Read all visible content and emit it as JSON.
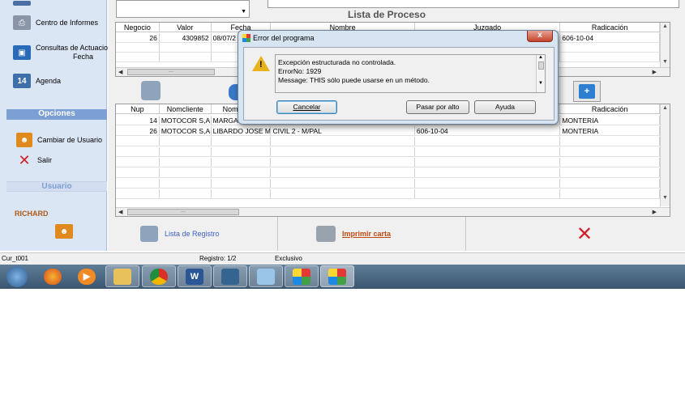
{
  "sidebar": {
    "items": [
      {
        "label": "Centro de Informes",
        "icon": "printer-icon"
      },
      {
        "label": "Consultas de Actuaciones",
        "label2": "Fecha",
        "icon": "monitor-icon"
      },
      {
        "label": "Agenda",
        "icon": "calendar-icon",
        "icon_text": "14"
      }
    ],
    "options_header": "Opciones",
    "options": [
      {
        "label": "Cambiar de Usuario",
        "icon": "users-icon"
      },
      {
        "label": "Salir",
        "icon": "exit-x-icon"
      }
    ],
    "user_header": "Usuario",
    "user_name": "RICHARD"
  },
  "process_list": {
    "title": "Lista de Proceso",
    "columns": [
      "Negocio",
      "Valor",
      "Fecha",
      "Nombre",
      "Juzgado",
      "Radicación"
    ],
    "rows": [
      {
        "negocio": "26",
        "valor": "4309852",
        "fecha": "08/07/2",
        "nombre": "",
        "juzgado": "",
        "radicacion": "606-10-04"
      }
    ]
  },
  "detail_list": {
    "columns": [
      "Nup",
      "Nomcliente",
      "Nom",
      "",
      "",
      "Radicación"
    ],
    "rows": [
      {
        "nup": "14",
        "cliente": "MOTOCOR S,A (",
        "nom": "MARGA",
        "c4": "",
        "c5": "",
        "radicacion": "MONTERIA"
      },
      {
        "nup": "26",
        "cliente": "MOTOCOR S,A (",
        "nom": "LIBARDO JOSE M",
        "c4": "CIVIL 2 - M/PAL",
        "c5": "606-10-04",
        "radicacion": "MONTERIA"
      }
    ]
  },
  "footer": {
    "lista_registro": "Lista de Registro",
    "imprimir_carta": "Imprimir carta"
  },
  "statusbar": {
    "form": "Cur_t001",
    "registro": "Registro: 1/2",
    "mode": "Exclusivo"
  },
  "dialog": {
    "title": "Error del programa",
    "close": "x",
    "line1": "Excepción estructurada no controlada.",
    "line2": "ErrorNo: 1929",
    "line3": "Message: THIS sólo puede usarse en un método.",
    "btn_cancel": "Cancelar",
    "btn_pasar": "Pasar por alto",
    "btn_ayuda": "Ayuda"
  },
  "taskbar": {
    "apps": [
      "windows-start-icon",
      "firefox-icon",
      "media-player-icon",
      "file-explorer-icon",
      "chrome-icon",
      "word-icon",
      "postgres-icon",
      "notepad-icon",
      "foxpro-icon",
      "foxpro-icon"
    ],
    "word_letter": "W"
  },
  "colors": {
    "sidebar_bg": "#dbe6f4",
    "accent": "#7c9fd4",
    "link": "#3b5fc4",
    "link_orange": "#c04a10",
    "close_red": "#c5442c"
  }
}
